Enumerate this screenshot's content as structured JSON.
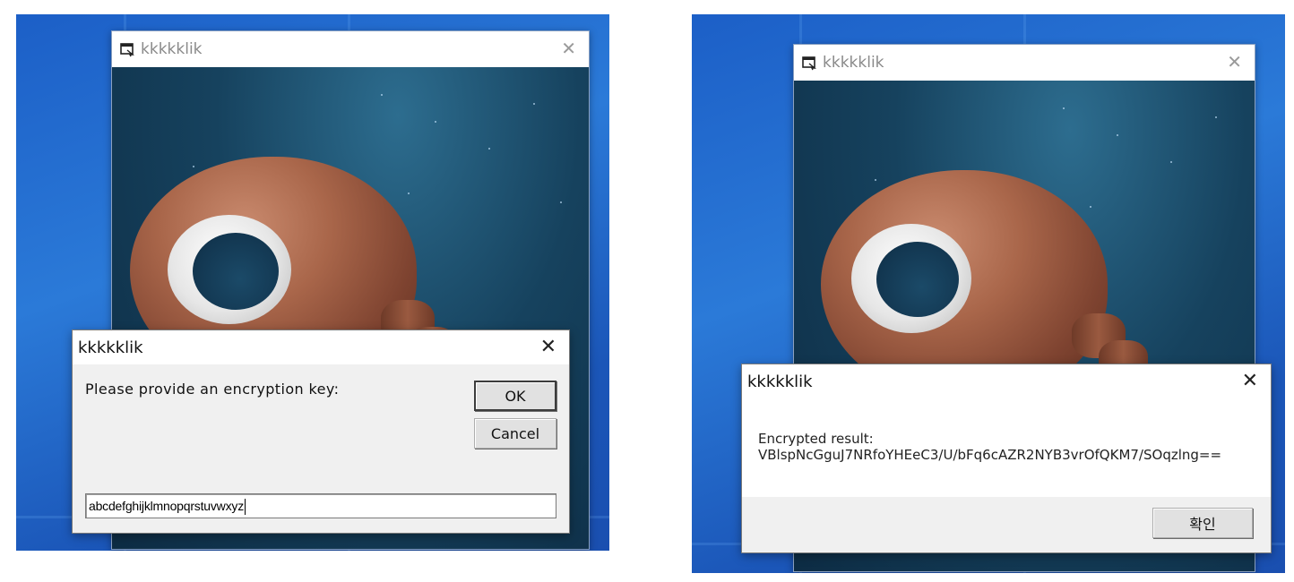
{
  "left_screen": {
    "image_window": {
      "title": "kkkkklik",
      "close_glyph": "✕",
      "icon": "app-window-icon"
    },
    "input_dialog": {
      "title": "kkkkklik",
      "close_glyph": "✕",
      "prompt": "Please provide an encryption key:",
      "ok_label": "OK",
      "cancel_label": "Cancel",
      "input_value": "abcdefghijklmnopqrstuvwxyz"
    }
  },
  "right_screen": {
    "image_window": {
      "title": "kkkkklik",
      "close_glyph": "✕",
      "icon": "app-window-icon"
    },
    "result_dialog": {
      "title": "kkkkklik",
      "close_glyph": "✕",
      "result_label": "Encrypted result:",
      "result_value": "VBlspNcGguJ7NRfoYHEeC3/U/bFq6cAZR2NYB3vrOfQKM7/SOqzlng==",
      "confirm_label": "확인"
    }
  },
  "colors": {
    "desktop_blue": "#2b7ad8",
    "dialog_gray": "#f0f0f0",
    "title_gray_text": "#8a8a8a"
  }
}
